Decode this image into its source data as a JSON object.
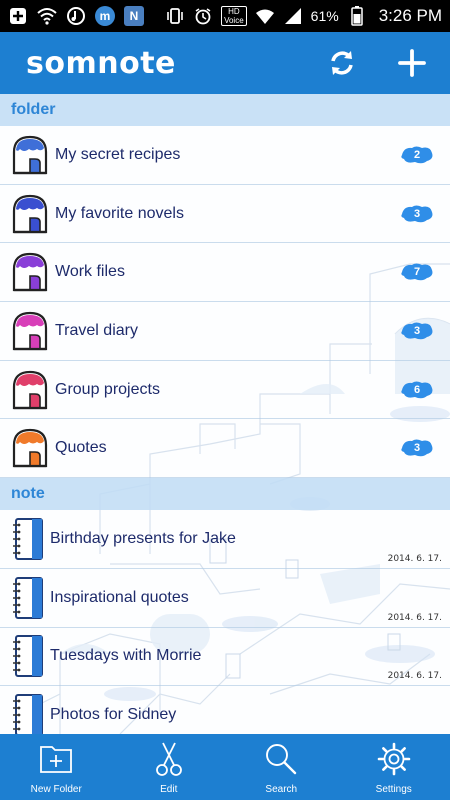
{
  "status_bar": {
    "badge_m": "m",
    "badge_n": "N",
    "hd_top": "HD",
    "hd_bottom": "Voice",
    "battery": "61%",
    "time": "3:26 PM"
  },
  "app": {
    "logo": "somnote",
    "brand_color": "#1d7fd1"
  },
  "sections": {
    "folder_title": "folder",
    "note_title": "note"
  },
  "folders": [
    {
      "label": "My secret recipes",
      "count": "2",
      "color": "#3f6fd8"
    },
    {
      "label": "My favorite novels",
      "count": "3",
      "color": "#3a4fd0"
    },
    {
      "label": "Work files",
      "count": "7",
      "color": "#8a3fd8"
    },
    {
      "label": "Travel diary",
      "count": "3",
      "color": "#d83fb8"
    },
    {
      "label": "Group projects",
      "count": "6",
      "color": "#e03f6a"
    },
    {
      "label": "Quotes",
      "count": "3",
      "color": "#f07a2a"
    }
  ],
  "notes": [
    {
      "label": "Birthday presents for Jake",
      "date": "2014. 6. 17."
    },
    {
      "label": "Inspirational quotes",
      "date": "2014. 6. 17."
    },
    {
      "label": "Tuesdays with Morrie",
      "date": "2014. 6. 17."
    },
    {
      "label": "Photos for Sidney",
      "date": ""
    }
  ],
  "bottom_tabs": [
    {
      "label": "New Folder",
      "icon": "new-folder-icon"
    },
    {
      "label": "Edit",
      "icon": "scissors-icon"
    },
    {
      "label": "Search",
      "icon": "search-icon"
    },
    {
      "label": "Settings",
      "icon": "gear-icon"
    }
  ]
}
